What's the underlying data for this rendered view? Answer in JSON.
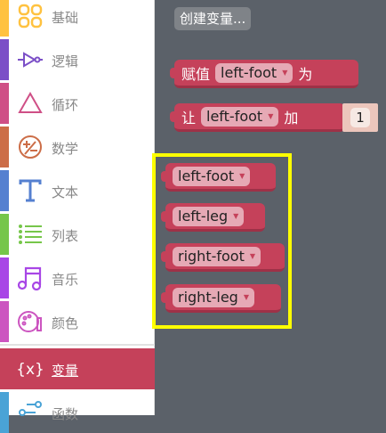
{
  "sidebar": {
    "categories": [
      {
        "label": "基础",
        "color": "#ffc240",
        "icon": "grid-icon"
      },
      {
        "label": "逻辑",
        "color": "#7b4fc7",
        "icon": "logic-gate-icon"
      },
      {
        "label": "循环",
        "color": "#cf4f86",
        "icon": "recycle-loop-icon"
      },
      {
        "label": "数学",
        "color": "#cc6d47",
        "icon": "math-plus-minus-icon"
      },
      {
        "label": "文本",
        "color": "#5580d0",
        "icon": "text-t-icon"
      },
      {
        "label": "列表",
        "color": "#76c64a",
        "icon": "list-icon"
      },
      {
        "label": "音乐",
        "color": "#a846e6",
        "icon": "music-note-icon"
      },
      {
        "label": "颜色",
        "color": "#cc55c0",
        "icon": "palette-icon"
      },
      {
        "label": "变量",
        "color": "#c5415a",
        "icon": "variable-braces-icon",
        "selected": true
      },
      {
        "label": "函数",
        "color": "#4aa3d6",
        "icon": "function-icon"
      }
    ]
  },
  "workspace": {
    "create_variable": "创建变量...",
    "set_block": {
      "prefix": "赋值",
      "variable": "left-foot",
      "suffix": "为"
    },
    "change_block": {
      "prefix": "让",
      "variable": "left-foot",
      "suffix": "加",
      "value": "1"
    },
    "variables": [
      "left-foot",
      "left-leg",
      "right-foot",
      "right-leg"
    ],
    "highlight_color": "#ffff00"
  }
}
